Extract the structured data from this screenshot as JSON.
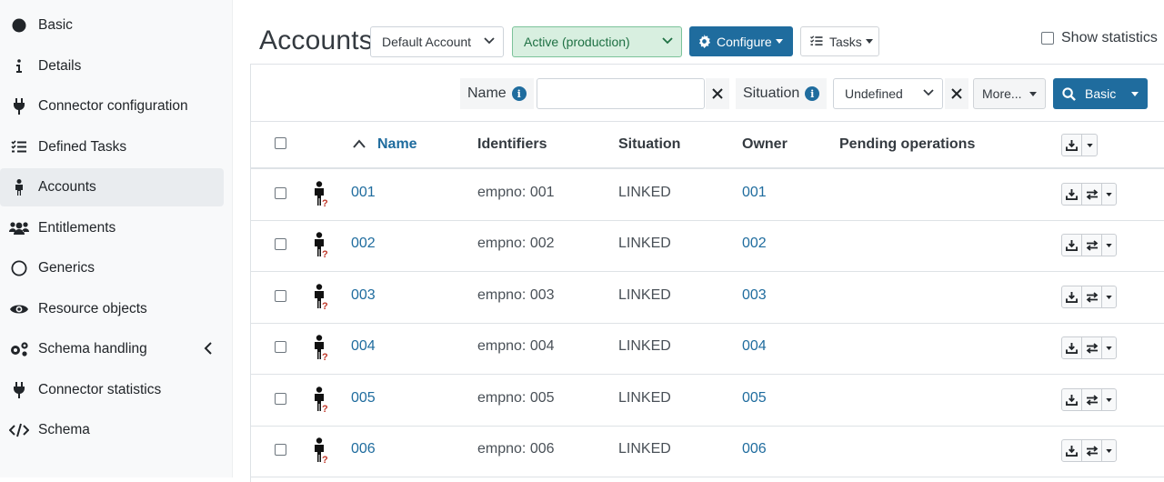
{
  "sidebar": {
    "items": [
      {
        "label": "Basic",
        "icon": "circle-filled-icon"
      },
      {
        "label": "Details",
        "icon": "info-icon"
      },
      {
        "label": "Connector configuration",
        "icon": "plug-icon"
      },
      {
        "label": "Defined Tasks",
        "icon": "task-list-icon"
      },
      {
        "label": "Accounts",
        "icon": "person-icon",
        "active": true
      },
      {
        "label": "Entitlements",
        "icon": "users-icon"
      },
      {
        "label": "Generics",
        "icon": "circle-outline-icon"
      },
      {
        "label": "Resource objects",
        "icon": "eye-icon"
      },
      {
        "label": "Schema handling",
        "icon": "cogs-icon"
      },
      {
        "label": "Connector statistics",
        "icon": "plug-icon"
      },
      {
        "label": "Schema",
        "icon": "code-icon"
      }
    ]
  },
  "header": {
    "title": "Accounts",
    "account_select": "Default Account",
    "mode_select": "Active (production)",
    "configure_label": "Configure",
    "tasks_label": "Tasks",
    "show_statistics_label": "Show statistics"
  },
  "filters": {
    "name_label": "Name",
    "name_value": "",
    "situation_label": "Situation",
    "situation_value": "Undefined",
    "more_label": "More...",
    "search_mode_label": "Basic"
  },
  "table": {
    "columns": [
      "Name",
      "Identifiers",
      "Situation",
      "Owner",
      "Pending operations"
    ],
    "sort_column": "Name",
    "rows": [
      {
        "name": "001",
        "identifiers": "empno: 001",
        "situation": "LINKED",
        "owner": "001",
        "pending": ""
      },
      {
        "name": "002",
        "identifiers": "empno: 002",
        "situation": "LINKED",
        "owner": "002",
        "pending": ""
      },
      {
        "name": "003",
        "identifiers": "empno: 003",
        "situation": "LINKED",
        "owner": "003",
        "pending": ""
      },
      {
        "name": "004",
        "identifiers": "empno: 004",
        "situation": "LINKED",
        "owner": "004",
        "pending": ""
      },
      {
        "name": "005",
        "identifiers": "empno: 005",
        "situation": "LINKED",
        "owner": "005",
        "pending": ""
      },
      {
        "name": "006",
        "identifiers": "empno: 006",
        "situation": "LINKED",
        "owner": "006",
        "pending": ""
      }
    ]
  },
  "colors": {
    "primary": "#1f6c9e",
    "success_bg": "#d8efe0",
    "link": "#1f6c9e",
    "warning_mark": "#c0392b"
  }
}
